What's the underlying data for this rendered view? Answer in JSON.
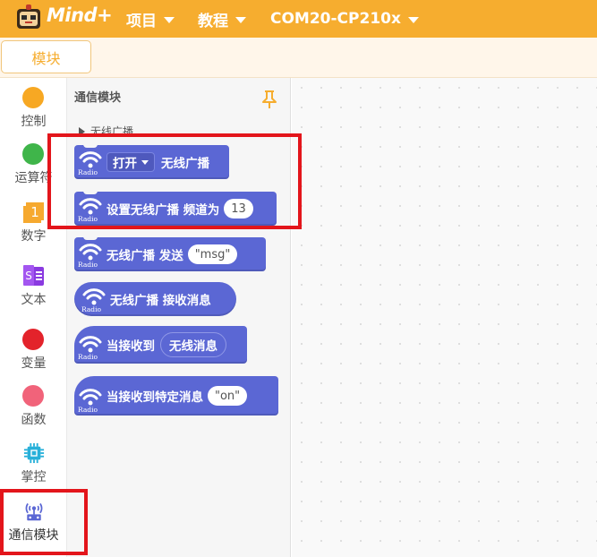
{
  "app": {
    "logo_text": "Mind+"
  },
  "menu": {
    "project": "项目",
    "tutorial": "教程",
    "port": "COM20-CP210x"
  },
  "tabs": {
    "blocks": "模块"
  },
  "categories": [
    {
      "label": "控制",
      "color": "#f7a823",
      "icon": "control-dot"
    },
    {
      "label": "运算符",
      "color": "#3fb54a",
      "icon": "operators-dot"
    },
    {
      "label": "数字",
      "color": "#f6a92f",
      "icon": "number-icon",
      "badge": "1"
    },
    {
      "label": "文本",
      "color": "#8a3ae0",
      "icon": "text-icon",
      "badge": "S"
    },
    {
      "label": "变量",
      "color": "#e3232b",
      "icon": "variable-dot"
    },
    {
      "label": "函数",
      "color": "#f1637a",
      "icon": "function-dot"
    },
    {
      "label": "掌控",
      "color": "#27b0d9",
      "icon": "chip-icon"
    },
    {
      "label": "通信模块",
      "color": "#5b67d4",
      "icon": "antenna-icon"
    }
  ],
  "flyout": {
    "title": "通信模块",
    "section": "无线广播",
    "radio_label": "Radio",
    "blocks": {
      "turn_on": {
        "dropdown": "打开",
        "text": "无线广播"
      },
      "set_channel": {
        "text": "设置无线广播 频道为",
        "value": "13"
      },
      "send": {
        "text": "无线广播 发送",
        "value": "\"msg\""
      },
      "receive": {
        "text": "无线广播 接收消息"
      },
      "when_received": {
        "text": "当接收到",
        "param": "无线消息"
      },
      "when_specific": {
        "text": "当接收到特定消息",
        "value": "\"on\""
      }
    }
  },
  "colors": {
    "topbar": "#f6ad2f",
    "block": "#5b67d4",
    "highlight": "#e3151b"
  }
}
